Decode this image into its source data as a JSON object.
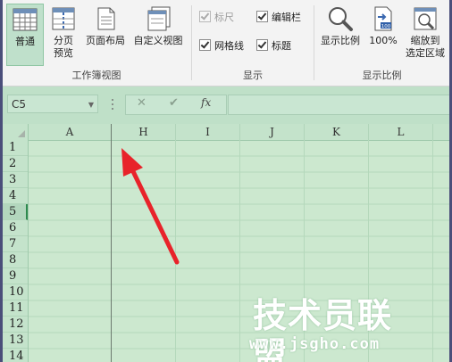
{
  "ribbon": {
    "workbook_views": {
      "label": "工作簿视图",
      "buttons": [
        {
          "line1": "普通",
          "line2": "",
          "active": true
        },
        {
          "line1": "分页",
          "line2": "预览"
        },
        {
          "line1": "页面布局",
          "line2": ""
        },
        {
          "line1": "自定义视图",
          "line2": ""
        }
      ]
    },
    "show": {
      "label": "显示",
      "checks": [
        {
          "label": "标尺",
          "checked": true,
          "disabled": true
        },
        {
          "label": "编辑栏",
          "checked": true,
          "disabled": false
        },
        {
          "label": "网格线",
          "checked": true,
          "disabled": false
        },
        {
          "label": "标题",
          "checked": true,
          "disabled": false
        }
      ]
    },
    "zoom": {
      "label": "显示比例",
      "buttons": [
        {
          "line1": "显示比例",
          "line2": ""
        },
        {
          "line1": "100%",
          "line2": ""
        },
        {
          "line1": "缩放到",
          "line2": "选定区域"
        }
      ]
    }
  },
  "formula_bar": {
    "name_box": "C5",
    "cancel_glyph": "✕",
    "enter_glyph": "✔",
    "fx_glyph": "fx",
    "formula": ""
  },
  "sheet": {
    "columns": [
      "A",
      "H",
      "I",
      "J",
      "K",
      "L"
    ],
    "rows": [
      "1",
      "2",
      "3",
      "4",
      "5",
      "6",
      "7",
      "8",
      "9",
      "10",
      "11",
      "12",
      "13",
      "14"
    ],
    "selected_row": "5"
  },
  "watermark": {
    "title": "技术员联盟",
    "url": "www.jsgho.com"
  },
  "colors": {
    "sheet_bg": "#cce8cf",
    "header_bg": "#c4e3cb",
    "arrow": "#e8232a",
    "frame": "#4a4e7a"
  },
  "icons": {
    "normal": "grid-view-icon",
    "page_break": "page-break-icon",
    "page_layout": "page-layout-icon",
    "custom_view": "custom-view-icon",
    "zoom": "magnifier-icon",
    "zoom_100": "zoom-100-icon",
    "zoom_selection": "zoom-selection-icon"
  }
}
